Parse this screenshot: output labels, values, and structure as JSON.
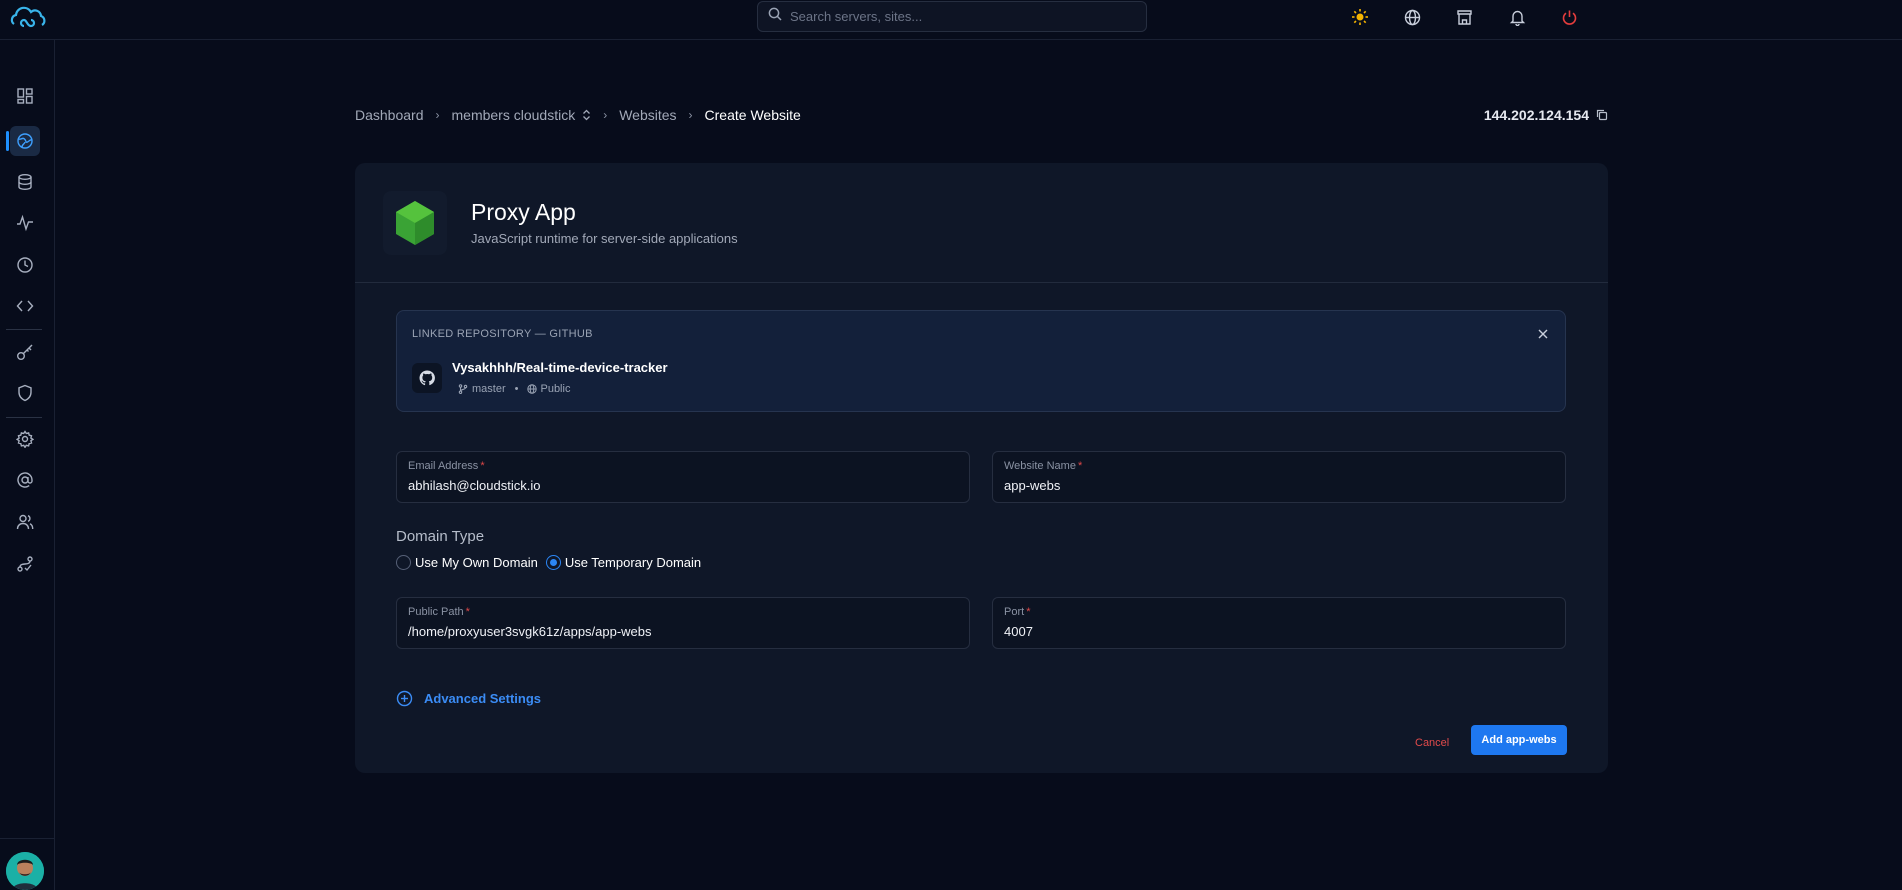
{
  "search": {
    "placeholder": "Search servers, sites..."
  },
  "breadcrumb": {
    "items": [
      "Dashboard",
      "members cloudstick",
      "Websites",
      "Create Website"
    ]
  },
  "server": {
    "ip": "144.202.124.154"
  },
  "app": {
    "title": "Proxy App",
    "description": "JavaScript runtime for server-side applications"
  },
  "repository": {
    "label": "LINKED REPOSITORY — GITHUB",
    "name": "Vysakhhh/Real-time-device-tracker",
    "branch": "master",
    "visibility": "Public"
  },
  "form": {
    "email": {
      "label": "Email Address",
      "value": "abhilash@cloudstick.io"
    },
    "website_name": {
      "label": "Website Name",
      "value": "app-webs"
    },
    "domain_type": {
      "label": "Domain Type",
      "options": [
        "Use My Own Domain",
        "Use Temporary Domain"
      ],
      "selected": "Use Temporary Domain"
    },
    "public_path": {
      "label": "Public Path",
      "value": "/home/proxyuser3svgk61z/apps/app-webs"
    },
    "port": {
      "label": "Port",
      "value": "4007"
    }
  },
  "advanced": {
    "label": "Advanced Settings"
  },
  "actions": {
    "cancel": "Cancel",
    "submit": "Add app-webs"
  },
  "colors": {
    "accent": "#1e78f0",
    "danger": "#e24b4b",
    "node_green": "#3aa335",
    "background": "#070c1b",
    "card": "#0f1728"
  },
  "icons": {
    "sidebar": [
      "dashboard-icon",
      "websites-icon",
      "database-icon",
      "activity-icon",
      "clock-icon",
      "code-icon",
      "key-icon",
      "shield-icon",
      "settings-icon",
      "at-icon",
      "users-icon",
      "route-icon"
    ],
    "topbar": [
      "sun-icon",
      "globe-icon",
      "store-icon",
      "bell-icon",
      "power-icon"
    ]
  }
}
